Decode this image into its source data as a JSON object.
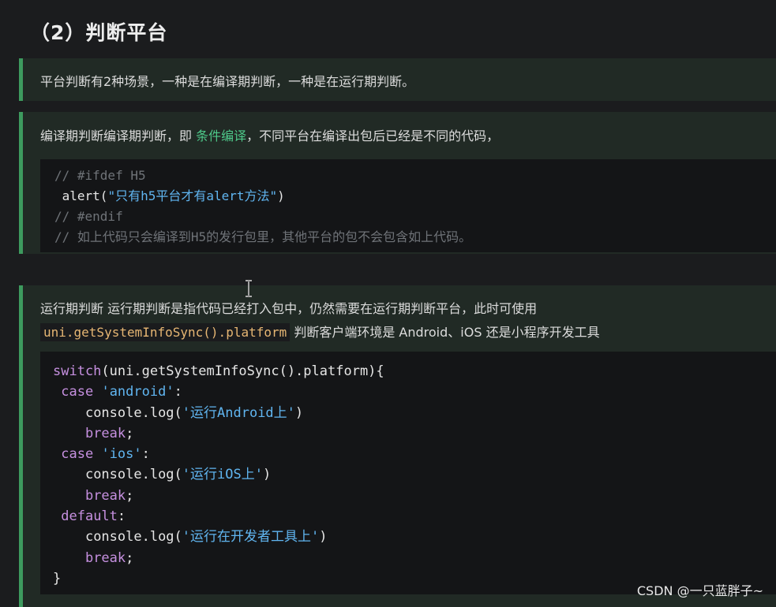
{
  "heading": "（2）判断平台",
  "block1": {
    "text": "平台判断有2种场景，一种是在编译期判断，一种是在运行期判断。"
  },
  "block2": {
    "text_before": "编译期判断编译期判断，即 ",
    "highlight": "条件编译",
    "text_after": "，不同平台在编译出包后已经是不同的代码，",
    "code": {
      "line1": "// #ifdef H5",
      "line2_fn": " alert(",
      "line2_str": "\"只有h5平台才有alert方法\"",
      "line2_end": ")",
      "line3": "// #endif",
      "line4": "// 如上代码只会编译到H5的发行包里，其他平台的包不会包含如上代码。"
    }
  },
  "block3": {
    "line1": "运行期判断 运行期判断是指代码已经打入包中，仍然需要在运行期判断平台，此时可使用",
    "inline_code": "uni.getSystemInfoSync().platform",
    "line2_after": " 判断客户端环境是 Android、iOS 还是小程序开发工具",
    "code": {
      "switch_kw": "switch",
      "switch_rest": "(uni.getSystemInfoSync().platform){",
      "case_kw": "case",
      "case1_str": "'android'",
      "case2_str": "'ios'",
      "colon": ":",
      "console_log": "console.log(",
      "log1_str": "'运行Android上'",
      "log2_str": "'运行iOS上'",
      "log3_str": "'运行在开发者工具上'",
      "paren_close": ")",
      "break_kw": "break",
      "semicolon": ";",
      "default_kw": "default",
      "close_brace": "}"
    }
  },
  "watermark": "CSDN @一只蓝胖子~",
  "colors": {
    "accent_green": "#3d9a5e",
    "string_blue": "#60b5f0",
    "keyword_purple": "#c690e0",
    "comment_gray": "#6f7378"
  }
}
